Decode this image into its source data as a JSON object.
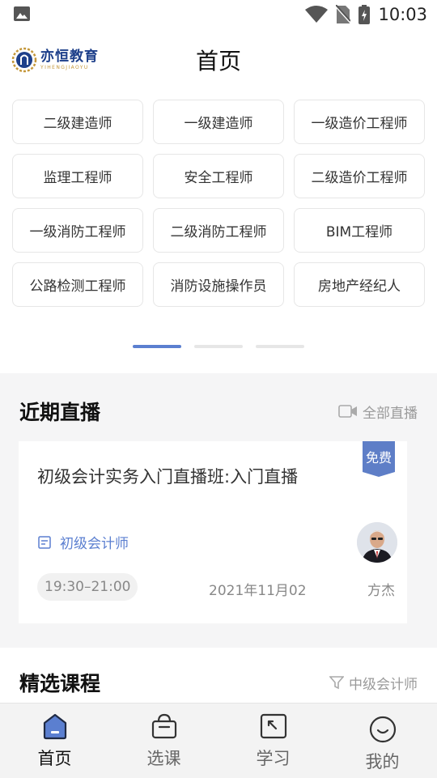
{
  "status_bar": {
    "time": "10:03"
  },
  "header": {
    "logo_name": "亦恒教育",
    "logo_sub": "YIHENGJIAOYU",
    "title": "首页"
  },
  "categories": [
    "二级建造师",
    "一级建造师",
    "一级造价工程师",
    "监理工程师",
    "安全工程师",
    "二级造价工程师",
    "一级消防工程师",
    "二级消防工程师",
    "BIM工程师",
    "公路检测工程师",
    "消防设施操作员",
    "房地产经纪人"
  ],
  "pager": {
    "pages": 3,
    "active": 0
  },
  "live": {
    "section_title": "近期直播",
    "all_link": "全部直播",
    "card": {
      "badge": "免费",
      "title": "初级会计实务入门直播班:入门直播",
      "category": "初级会计师",
      "time": "19:30–21:00",
      "date": "2021年11月02",
      "teacher": "方杰"
    }
  },
  "selected": {
    "section_title": "精选课程",
    "filter": "中级会计师"
  },
  "tabs": [
    {
      "label": "首页",
      "icon": "home-icon",
      "active": true
    },
    {
      "label": "选课",
      "icon": "basket-icon",
      "active": false
    },
    {
      "label": "学习",
      "icon": "study-icon",
      "active": false
    },
    {
      "label": "我的",
      "icon": "smile-icon",
      "active": false
    }
  ],
  "colors": {
    "accent": "#5b7fd0",
    "badge": "#5e7ec7",
    "logo": "#1d3f8a"
  }
}
